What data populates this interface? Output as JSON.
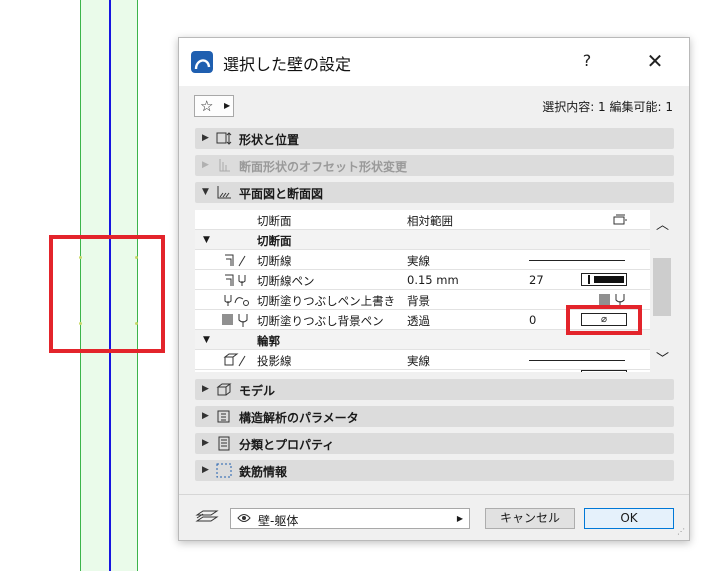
{
  "dialog": {
    "title": "選択した壁の設定",
    "help": "?",
    "close": "✕",
    "selection_info": "選択内容: 1 編集可能: 1"
  },
  "sections": {
    "shape": "形状と位置",
    "offset": "断面形状のオフセット形状変更",
    "plan": "平面図と断面図",
    "model": "モデル",
    "structural": "構造解析のパラメータ",
    "classification": "分類とプロパティ",
    "rebar": "鉄筋情報"
  },
  "grid": {
    "row_cut_plane": {
      "name": "切断面",
      "value": "相対範囲"
    },
    "sub_cut": "切断面",
    "row_cut_line": {
      "name": "切断線",
      "value": "実線"
    },
    "row_cut_pen": {
      "name": "切断線ペン",
      "value": "0.15 mm",
      "num": "27"
    },
    "row_fill_override": {
      "name": "切断塗りつぶしペン上書き",
      "value": "背景"
    },
    "row_fill_bg": {
      "name": "切断塗りつぶし背景ペン",
      "value": "透過",
      "num": "0",
      "sample": "⌀"
    },
    "sub_outline": "輪郭",
    "row_proj_line": {
      "name": "投影線",
      "value": "実線"
    }
  },
  "footer": {
    "layer": "壁-躯体",
    "cancel": "キャンセル",
    "ok": "OK"
  },
  "colors": {
    "highlight": "#e3242b",
    "wall_line": "#1616e0",
    "wall_border": "#3cb44b"
  }
}
